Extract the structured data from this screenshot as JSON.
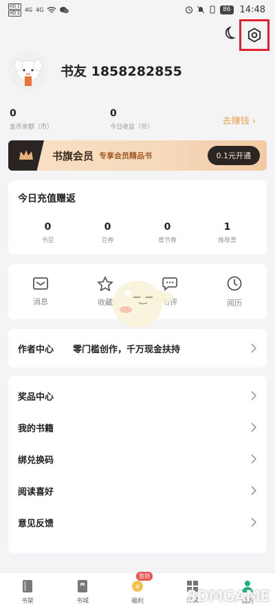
{
  "status": {
    "time": "14:48",
    "battery": "86",
    "sim1": "HD 1",
    "sim2": "HD 2",
    "net1": "4G",
    "net2": "4G"
  },
  "profile": {
    "username": "书友 1858282855"
  },
  "stats": [
    {
      "value": "0",
      "label": "金币余额（币）"
    },
    {
      "value": "0",
      "label": "今日收益（币）"
    }
  ],
  "earn_label": "去赚钱 ›",
  "vip": {
    "title": "书旗会员",
    "subtitle": "专享会员精品书",
    "button": "0.1元开通"
  },
  "recharge": {
    "title": "今日充值赠返",
    "items": [
      {
        "value": "0",
        "label": "书豆"
      },
      {
        "value": "0",
        "label": "豆券"
      },
      {
        "value": "0",
        "label": "章节券"
      },
      {
        "value": "1",
        "label": "推荐票"
      }
    ]
  },
  "quick": [
    {
      "label": "消息",
      "icon": "message-icon"
    },
    {
      "label": "收藏",
      "icon": "star-icon"
    },
    {
      "label": "书评",
      "icon": "comment-icon"
    },
    {
      "label": "阅历",
      "icon": "history-icon"
    }
  ],
  "author": {
    "title": "作者中心",
    "desc": "零门槛创作，千万现金扶持"
  },
  "menu": [
    "奖品中心",
    "我的书籍",
    "绑兑换码",
    "阅读喜好",
    "意见反馈"
  ],
  "tabs": [
    {
      "label": "书架",
      "icon": "bookshelf-icon"
    },
    {
      "label": "书城",
      "icon": "bookstore-icon"
    },
    {
      "label": "福利",
      "icon": "welfare-icon",
      "badge": "签到"
    },
    {
      "label": "分类",
      "icon": "category-icon"
    },
    {
      "label": "我的",
      "icon": "profile-icon"
    }
  ],
  "watermark": "3DMGAME",
  "colors": {
    "accent": "#e8a24a",
    "highlight": "#e0202a",
    "active_tab": "#20b07a"
  }
}
